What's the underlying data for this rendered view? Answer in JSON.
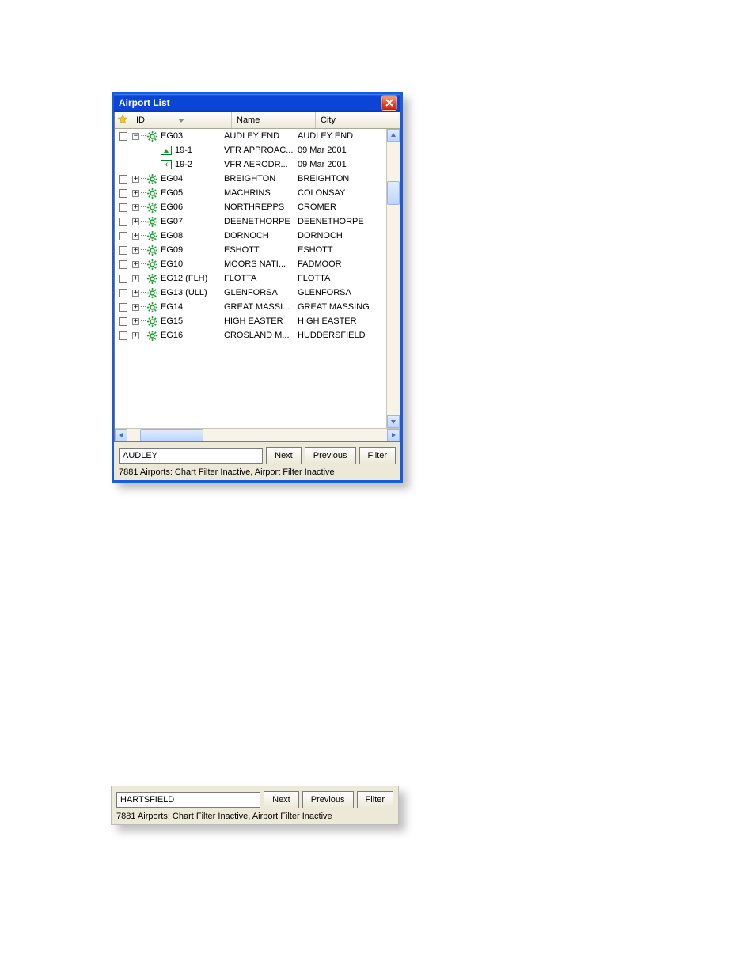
{
  "window": {
    "title": "Airport List",
    "columns": {
      "star": "",
      "id": "ID",
      "name": "Name",
      "city": "City"
    },
    "rows": [
      {
        "checkbox": true,
        "exp": "-",
        "indent": 0,
        "icon": "gear",
        "id": "EG03",
        "name": "AUDLEY END",
        "city": "AUDLEY END"
      },
      {
        "checkbox": false,
        "exp": "",
        "indent": 2,
        "icon": "pic1",
        "id": "19-1",
        "name": "VFR APPROAC...",
        "city": "09 Mar 2001"
      },
      {
        "checkbox": false,
        "exp": "",
        "indent": 2,
        "icon": "pic2",
        "id": "19-2",
        "name": "VFR AERODR...",
        "city": "09 Mar 2001"
      },
      {
        "checkbox": true,
        "exp": "+",
        "indent": 0,
        "icon": "gear",
        "id": "EG04",
        "name": "BREIGHTON",
        "city": "BREIGHTON"
      },
      {
        "checkbox": true,
        "exp": "+",
        "indent": 0,
        "icon": "gear",
        "id": "EG05",
        "name": "MACHRINS",
        "city": "COLONSAY"
      },
      {
        "checkbox": true,
        "exp": "+",
        "indent": 0,
        "icon": "gear",
        "id": "EG06",
        "name": "NORTHREPPS",
        "city": "CROMER"
      },
      {
        "checkbox": true,
        "exp": "+",
        "indent": 0,
        "icon": "gear",
        "id": "EG07",
        "name": "DEENETHORPE",
        "city": "DEENETHORPE"
      },
      {
        "checkbox": true,
        "exp": "+",
        "indent": 0,
        "icon": "gear",
        "id": "EG08",
        "name": "DORNOCH",
        "city": "DORNOCH"
      },
      {
        "checkbox": true,
        "exp": "+",
        "indent": 0,
        "icon": "gear",
        "id": "EG09",
        "name": "ESHOTT",
        "city": "ESHOTT"
      },
      {
        "checkbox": true,
        "exp": "+",
        "indent": 0,
        "icon": "gear",
        "id": "EG10",
        "name": "MOORS NATI...",
        "city": "FADMOOR"
      },
      {
        "checkbox": true,
        "exp": "+",
        "indent": 0,
        "icon": "gear",
        "id": "EG12 (FLH)",
        "name": "FLOTTA",
        "city": "FLOTTA"
      },
      {
        "checkbox": true,
        "exp": "+",
        "indent": 0,
        "icon": "gear",
        "id": "EG13 (ULL)",
        "name": "GLENFORSA",
        "city": "GLENFORSA"
      },
      {
        "checkbox": true,
        "exp": "+",
        "indent": 0,
        "icon": "gear",
        "id": "EG14",
        "name": "GREAT MASSI...",
        "city": "GREAT MASSING"
      },
      {
        "checkbox": true,
        "exp": "+",
        "indent": 0,
        "icon": "gear",
        "id": "EG15",
        "name": "HIGH EASTER",
        "city": "HIGH EASTER"
      },
      {
        "checkbox": true,
        "exp": "+",
        "indent": 0,
        "icon": "gear",
        "id": "EG16",
        "name": "CROSLAND M...",
        "city": "HUDDERSFIELD"
      }
    ],
    "search": {
      "value": "AUDLEY",
      "next": "Next",
      "previous": "Previous",
      "filter": "Filter"
    },
    "status": "7881 Airports: Chart Filter Inactive, Airport Filter Inactive"
  },
  "panel2": {
    "search": {
      "value": "HARTSFIELD",
      "next": "Next",
      "previous": "Previous",
      "filter": "Filter"
    },
    "status": "7881 Airports: Chart Filter Inactive, Airport Filter Inactive"
  }
}
